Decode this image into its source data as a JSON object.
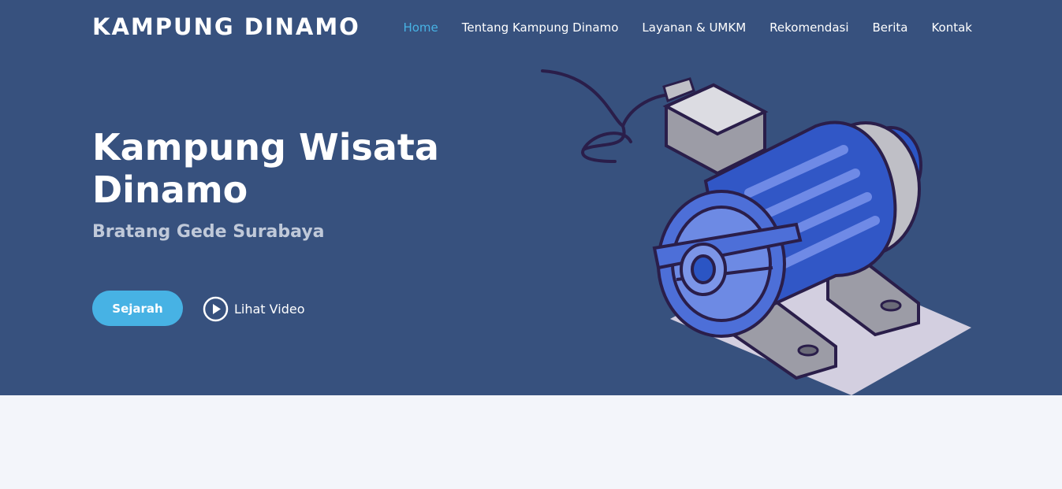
{
  "brand": {
    "name": "KAMPUNG DINAMO"
  },
  "nav": {
    "items": [
      {
        "label": "Home",
        "active": true
      },
      {
        "label": "Tentang Kampung Dinamo",
        "active": false
      },
      {
        "label": "Layanan & UMKM",
        "active": false
      },
      {
        "label": "Rekomendasi",
        "active": false
      },
      {
        "label": "Berita",
        "active": false
      },
      {
        "label": "Kontak",
        "active": false
      }
    ]
  },
  "hero": {
    "title": "Kampung Wisata Dinamo",
    "subtitle": "Bratang Gede Surabaya",
    "primary_button": "Sejarah",
    "video_link": "Lihat Video",
    "illustration_icon": "electric-motor-illustration"
  },
  "colors": {
    "hero_bg": "#37517e",
    "accent": "#47b2e4",
    "page_bg": "#f3f5fa"
  }
}
